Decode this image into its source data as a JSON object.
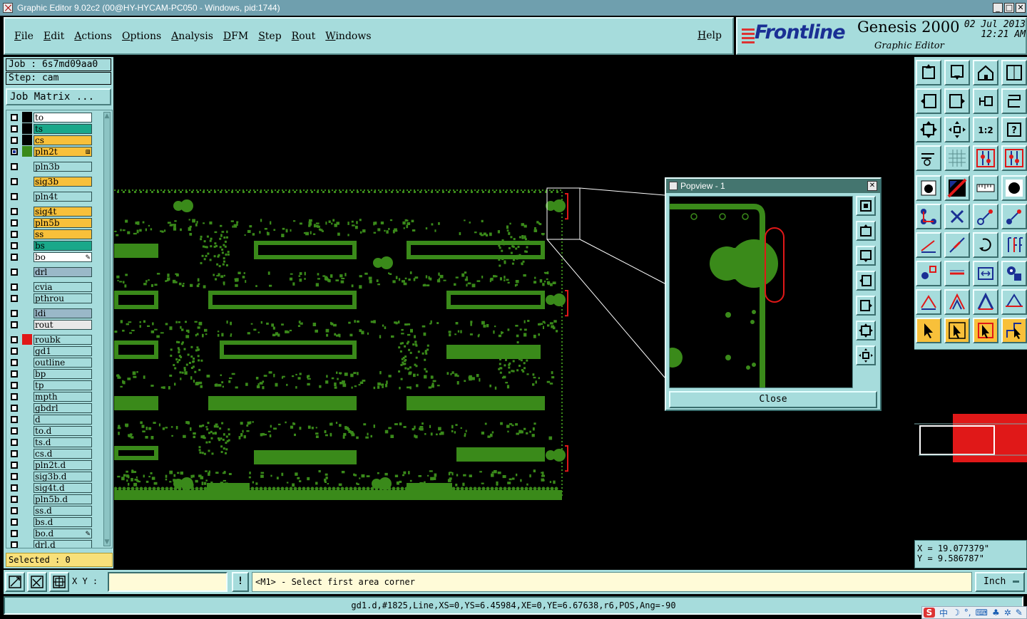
{
  "window": {
    "title": "Graphic Editor 9.02c2 (00@HY-HYCAM-PC050 - Windows, pid:1744)",
    "min": "_",
    "max": "□",
    "close": "✕"
  },
  "menu": {
    "items": [
      "File",
      "Edit",
      "Actions",
      "Options",
      "Analysis",
      "DFM",
      "Step",
      "Rout",
      "Windows"
    ],
    "help": "Help"
  },
  "logo": {
    "brand": "Frontline",
    "product": "Genesis 2000",
    "subtitle": "Graphic Editor",
    "date": "02 Jul 2013",
    "time": "12:21 AM"
  },
  "left": {
    "job": "Job : 6s7md09aa0",
    "step": "Step: cam",
    "job_matrix": "Job Matrix ...",
    "selected": "Selected : 0",
    "layers": [
      {
        "name": "to",
        "color": "#ffffff",
        "swatch": "#000000"
      },
      {
        "name": "ts",
        "color": "#1aa88a",
        "swatch": "#000000"
      },
      {
        "name": "cs",
        "color": "#f8c03a",
        "swatch": "#000000"
      },
      {
        "name": "pln2t",
        "color": "#f8c03a",
        "swatch": "#3a8a1a",
        "on": true,
        "icon": "⊞"
      },
      {
        "name": "pln3b",
        "color": "#a6dcdc",
        "swatch": "#a6dcdc"
      },
      {
        "name": "sig3b",
        "color": "#f8c03a",
        "swatch": "#a6dcdc"
      },
      {
        "name": "pln4t",
        "color": "#a6dcdc",
        "swatch": "#a6dcdc"
      },
      {
        "name": "sig4t",
        "color": "#f8c03a",
        "swatch": "#a6dcdc"
      },
      {
        "name": "pln5b",
        "color": "#f8c03a",
        "swatch": "#a6dcdc"
      },
      {
        "name": "ss",
        "color": "#f8c03a",
        "swatch": "#a6dcdc"
      },
      {
        "name": "bs",
        "color": "#1aa88a",
        "swatch": "#a6dcdc"
      },
      {
        "name": "bo",
        "color": "#ffffff",
        "swatch": "#a6dcdc",
        "icon": "✎"
      },
      {
        "name": "drl",
        "color": "#9ab8c8",
        "swatch": "#a6dcdc"
      },
      {
        "name": "cvia",
        "color": "#a6dcdc",
        "swatch": "#a6dcdc"
      },
      {
        "name": "pthrou",
        "color": "#a6dcdc",
        "swatch": "#a6dcdc"
      },
      {
        "name": "ldi",
        "color": "#9ab8c8",
        "swatch": "#a6dcdc"
      },
      {
        "name": "rout",
        "color": "#e8e8e8",
        "swatch": "#a6dcdc"
      },
      {
        "name": "roubk",
        "color": "#a6dcdc",
        "swatch": "#e01818"
      },
      {
        "name": "gd1",
        "color": "#a6dcdc",
        "swatch": "#a6dcdc"
      },
      {
        "name": "outline",
        "color": "#a6dcdc",
        "swatch": "#a6dcdc"
      },
      {
        "name": "bp",
        "color": "#a6dcdc",
        "swatch": "#a6dcdc"
      },
      {
        "name": "tp",
        "color": "#a6dcdc",
        "swatch": "#a6dcdc"
      },
      {
        "name": "mpth",
        "color": "#a6dcdc",
        "swatch": "#a6dcdc"
      },
      {
        "name": "gbdrl",
        "color": "#a6dcdc",
        "swatch": "#a6dcdc"
      },
      {
        "name": "d",
        "color": "#a6dcdc",
        "swatch": "#a6dcdc"
      },
      {
        "name": "to.d",
        "color": "#a6dcdc",
        "swatch": "#a6dcdc"
      },
      {
        "name": "ts.d",
        "color": "#a6dcdc",
        "swatch": "#a6dcdc"
      },
      {
        "name": "cs.d",
        "color": "#a6dcdc",
        "swatch": "#a6dcdc"
      },
      {
        "name": "pln2t.d",
        "color": "#a6dcdc",
        "swatch": "#a6dcdc"
      },
      {
        "name": "sig3b.d",
        "color": "#a6dcdc",
        "swatch": "#a6dcdc"
      },
      {
        "name": "sig4t.d",
        "color": "#a6dcdc",
        "swatch": "#a6dcdc"
      },
      {
        "name": "pln5b.d",
        "color": "#a6dcdc",
        "swatch": "#a6dcdc"
      },
      {
        "name": "ss.d",
        "color": "#a6dcdc",
        "swatch": "#a6dcdc"
      },
      {
        "name": "bs.d",
        "color": "#a6dcdc",
        "swatch": "#a6dcdc"
      },
      {
        "name": "bo.d",
        "color": "#a6dcdc",
        "swatch": "#a6dcdc",
        "icon": "✎"
      },
      {
        "name": "drl.d",
        "color": "#a6dcdc",
        "swatch": "#a6dcdc"
      }
    ]
  },
  "popview": {
    "title": "Popview - 1",
    "close_x": "✕",
    "close_button": "Close"
  },
  "coords": {
    "x": "X = 19.077379\"",
    "y": "Y = 9.586787\""
  },
  "bottom": {
    "xy_label": "X Y :",
    "xy_value": "",
    "bang": "!",
    "prompt": "<M1> - Select first area corner",
    "units": "Inch"
  },
  "status": {
    "text": "gd1.d,#1825,Line,XS=0,YS=6.45984,XE=0,YE=6.67638,r6,POS,Ang=-90"
  },
  "tray": {
    "s_icon": "S",
    "lang": "中",
    "moon": "☽",
    "dot": "°,",
    "kbd": "⌨",
    "person": "♣",
    "gear": "✲",
    "wrench": "✎"
  },
  "colors": {
    "panel": "#a6dcdc",
    "board": "#3a8a1a",
    "highlight": "#e01818",
    "prompt_bg": "#fffbd8"
  }
}
